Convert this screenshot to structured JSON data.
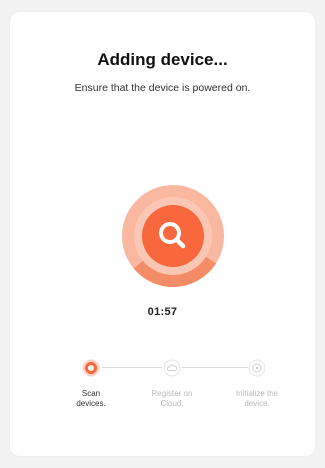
{
  "header": {
    "title": "Adding device...",
    "subtitle": "Ensure that the device is powered on."
  },
  "scanner": {
    "icon": "search-icon",
    "timer": "01:57",
    "progress": 0.3,
    "colors": {
      "core": "#f8683c",
      "ring": "#fab8a0",
      "ring_progress": "#f48c68"
    }
  },
  "steps": [
    {
      "label_line1": "Scan",
      "label_line2": "devices.",
      "icon": "scan-icon",
      "state": "active"
    },
    {
      "label_line1": "Register on",
      "label_line2": "Cloud.",
      "icon": "cloud-icon",
      "state": "pending"
    },
    {
      "label_line1": "Initialize the",
      "label_line2": "device.",
      "icon": "initialize-icon",
      "state": "pending"
    }
  ]
}
